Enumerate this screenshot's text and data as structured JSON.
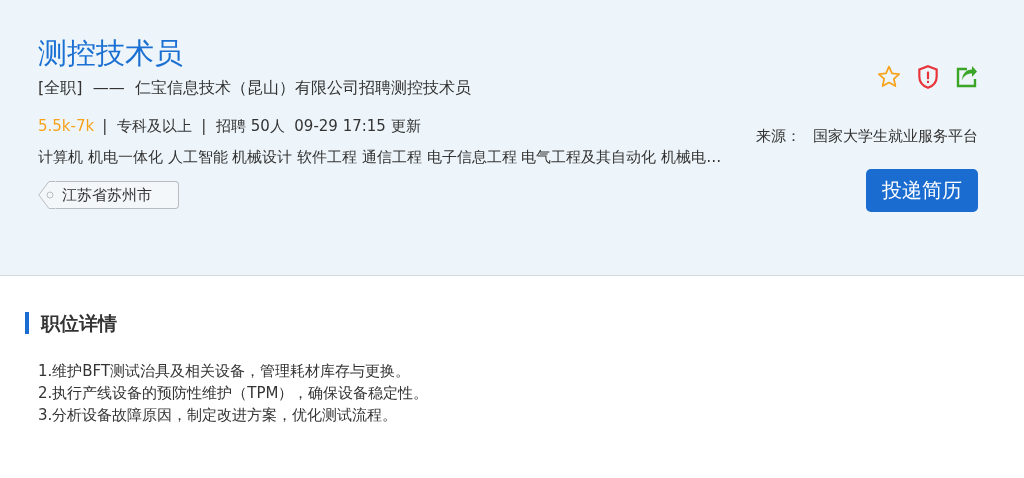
{
  "job": {
    "title": "测控技术员",
    "subtitle": "[全职]  ——  仁宝信息技术（昆山）有限公司招聘测控技术员",
    "salary": "5.5k-7k",
    "meta": "|  专科及以上  |  招聘 50人  09-29 17:15 更新",
    "source_label": "来源：",
    "source": "国家大学生就业服务平台",
    "majors": "计算机 机电一体化 人工智能 机械设计 软件工程 通信工程 电子信息工程 电气工程及其自动化 机械电…",
    "location": "江苏省苏州市",
    "apply_button": "投递简历"
  },
  "details": {
    "heading": "职位详情",
    "lines": [
      "1.维护BFT测试治具及相关设备，管理耗材库存与更换。",
      "2.执行产线设备的预防性维护（TPM），确保设备稳定性。",
      "3.分析设备故障原因，制定改进方案，优化测试流程。"
    ]
  }
}
